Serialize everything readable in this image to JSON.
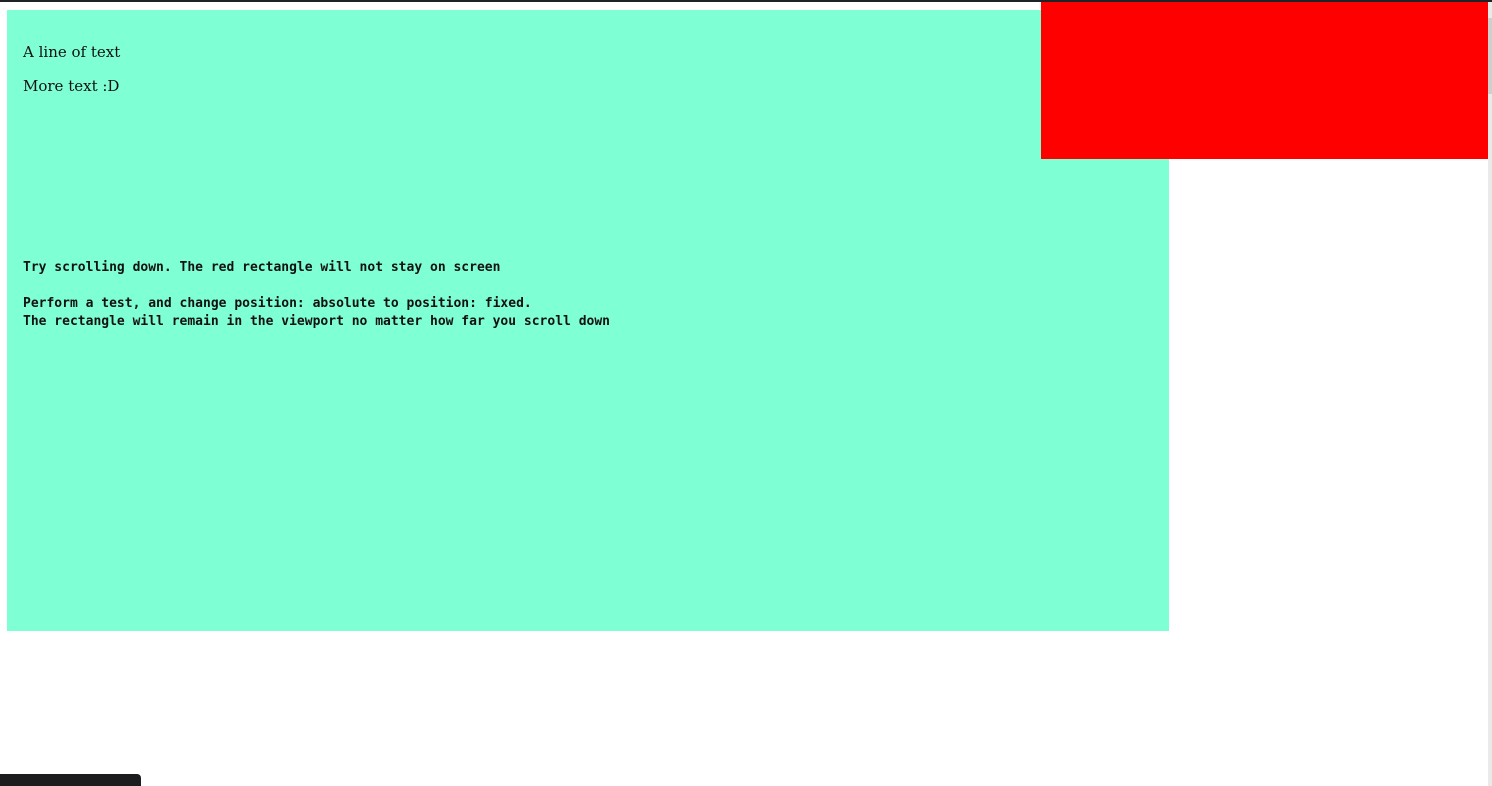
{
  "content": {
    "line1": "A line of text",
    "line2": "More text :D",
    "instructions": "Try scrolling down. The red rectangle will not stay on screen\n\nPerform a test, and change position: absolute to position: fixed.\nThe rectangle will remain in the viewport no matter how far you scroll down"
  },
  "colors": {
    "aqua_box": "#7fffd4",
    "red_rectangle": "#ff0000",
    "page_background": "#ffffff"
  }
}
